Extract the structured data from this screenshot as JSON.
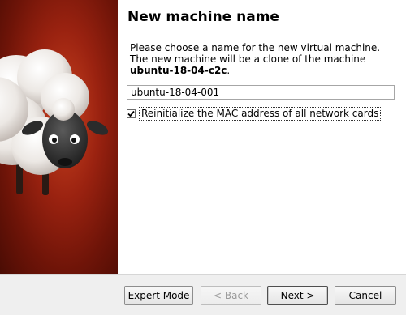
{
  "wizard": {
    "title": "New machine name",
    "description_line1": "Please choose a name for the new virtual machine.",
    "description_line2_prefix": "The new machine will be a clone of the machine",
    "source_machine": "ubuntu-18-04-c2c",
    "description_suffix": "."
  },
  "name_field": {
    "value": "ubuntu-18-04-001"
  },
  "mac_option": {
    "label": "Reinitialize the MAC address of all network cards",
    "checked": true
  },
  "buttons": {
    "expert_mode": {
      "label_first": "E",
      "label_rest": "xpert Mode"
    },
    "back": {
      "label_prefix": "< ",
      "label_first": "B",
      "label_rest": "ack"
    },
    "next": {
      "label_first": "N",
      "label_rest": "ext >"
    },
    "cancel": {
      "label": "Cancel"
    }
  },
  "colors": {
    "sidebar_red": "#9a2210",
    "bottom_bar": "#efefef"
  }
}
